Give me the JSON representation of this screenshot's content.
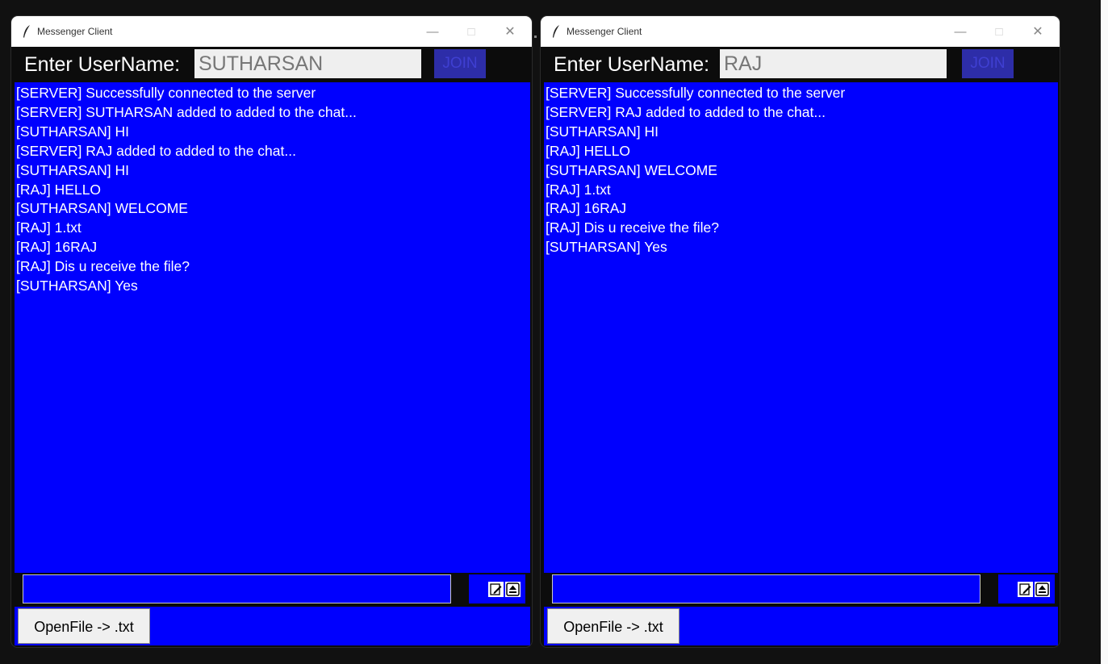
{
  "left_window": {
    "title": "Messenger Client",
    "username_label": "Enter UserName:",
    "username_value": "SUTHARSAN",
    "join_label": "JOIN",
    "messages": [
      "[SERVER] Successfully connected to the server",
      "[SERVER] SUTHARSAN added to added to the chat...",
      "[SUTHARSAN] HI",
      "[SERVER] RAJ added to added to the chat...",
      "[SUTHARSAN] HI",
      "[RAJ] HELLO",
      "[SUTHARSAN] WELCOME",
      "[RAJ] 1.txt",
      "[RAJ] 16RAJ",
      "[RAJ] Dis u receive the file?",
      "[SUTHARSAN] Yes"
    ],
    "message_input_value": "",
    "open_file_label": "OpenFile -> .txt"
  },
  "right_window": {
    "title": "Messenger Client",
    "username_label": "Enter UserName:",
    "username_value": "RAJ",
    "join_label": "JOIN",
    "messages": [
      "[SERVER] Successfully connected to the server",
      "[SERVER] RAJ added to added to the chat...",
      "[SUTHARSAN] HI",
      "[RAJ] HELLO",
      "[SUTHARSAN] WELCOME",
      "[RAJ] 1.txt",
      "[RAJ] 16RAJ",
      "[RAJ] Dis u receive the file?",
      "[SUTHARSAN] Yes"
    ],
    "message_input_value": "",
    "open_file_label": "OpenFile -> .txt"
  },
  "icons": {
    "app": "feather-icon",
    "minimize": "minimize-icon",
    "maximize": "maximize-icon",
    "close": "close-icon",
    "send": "edit-send-icon",
    "upload": "upload-icon"
  },
  "colors": {
    "chat_background": "#0000fe",
    "join_button": "#2d2da8",
    "window_background": "#0c0c0c"
  }
}
